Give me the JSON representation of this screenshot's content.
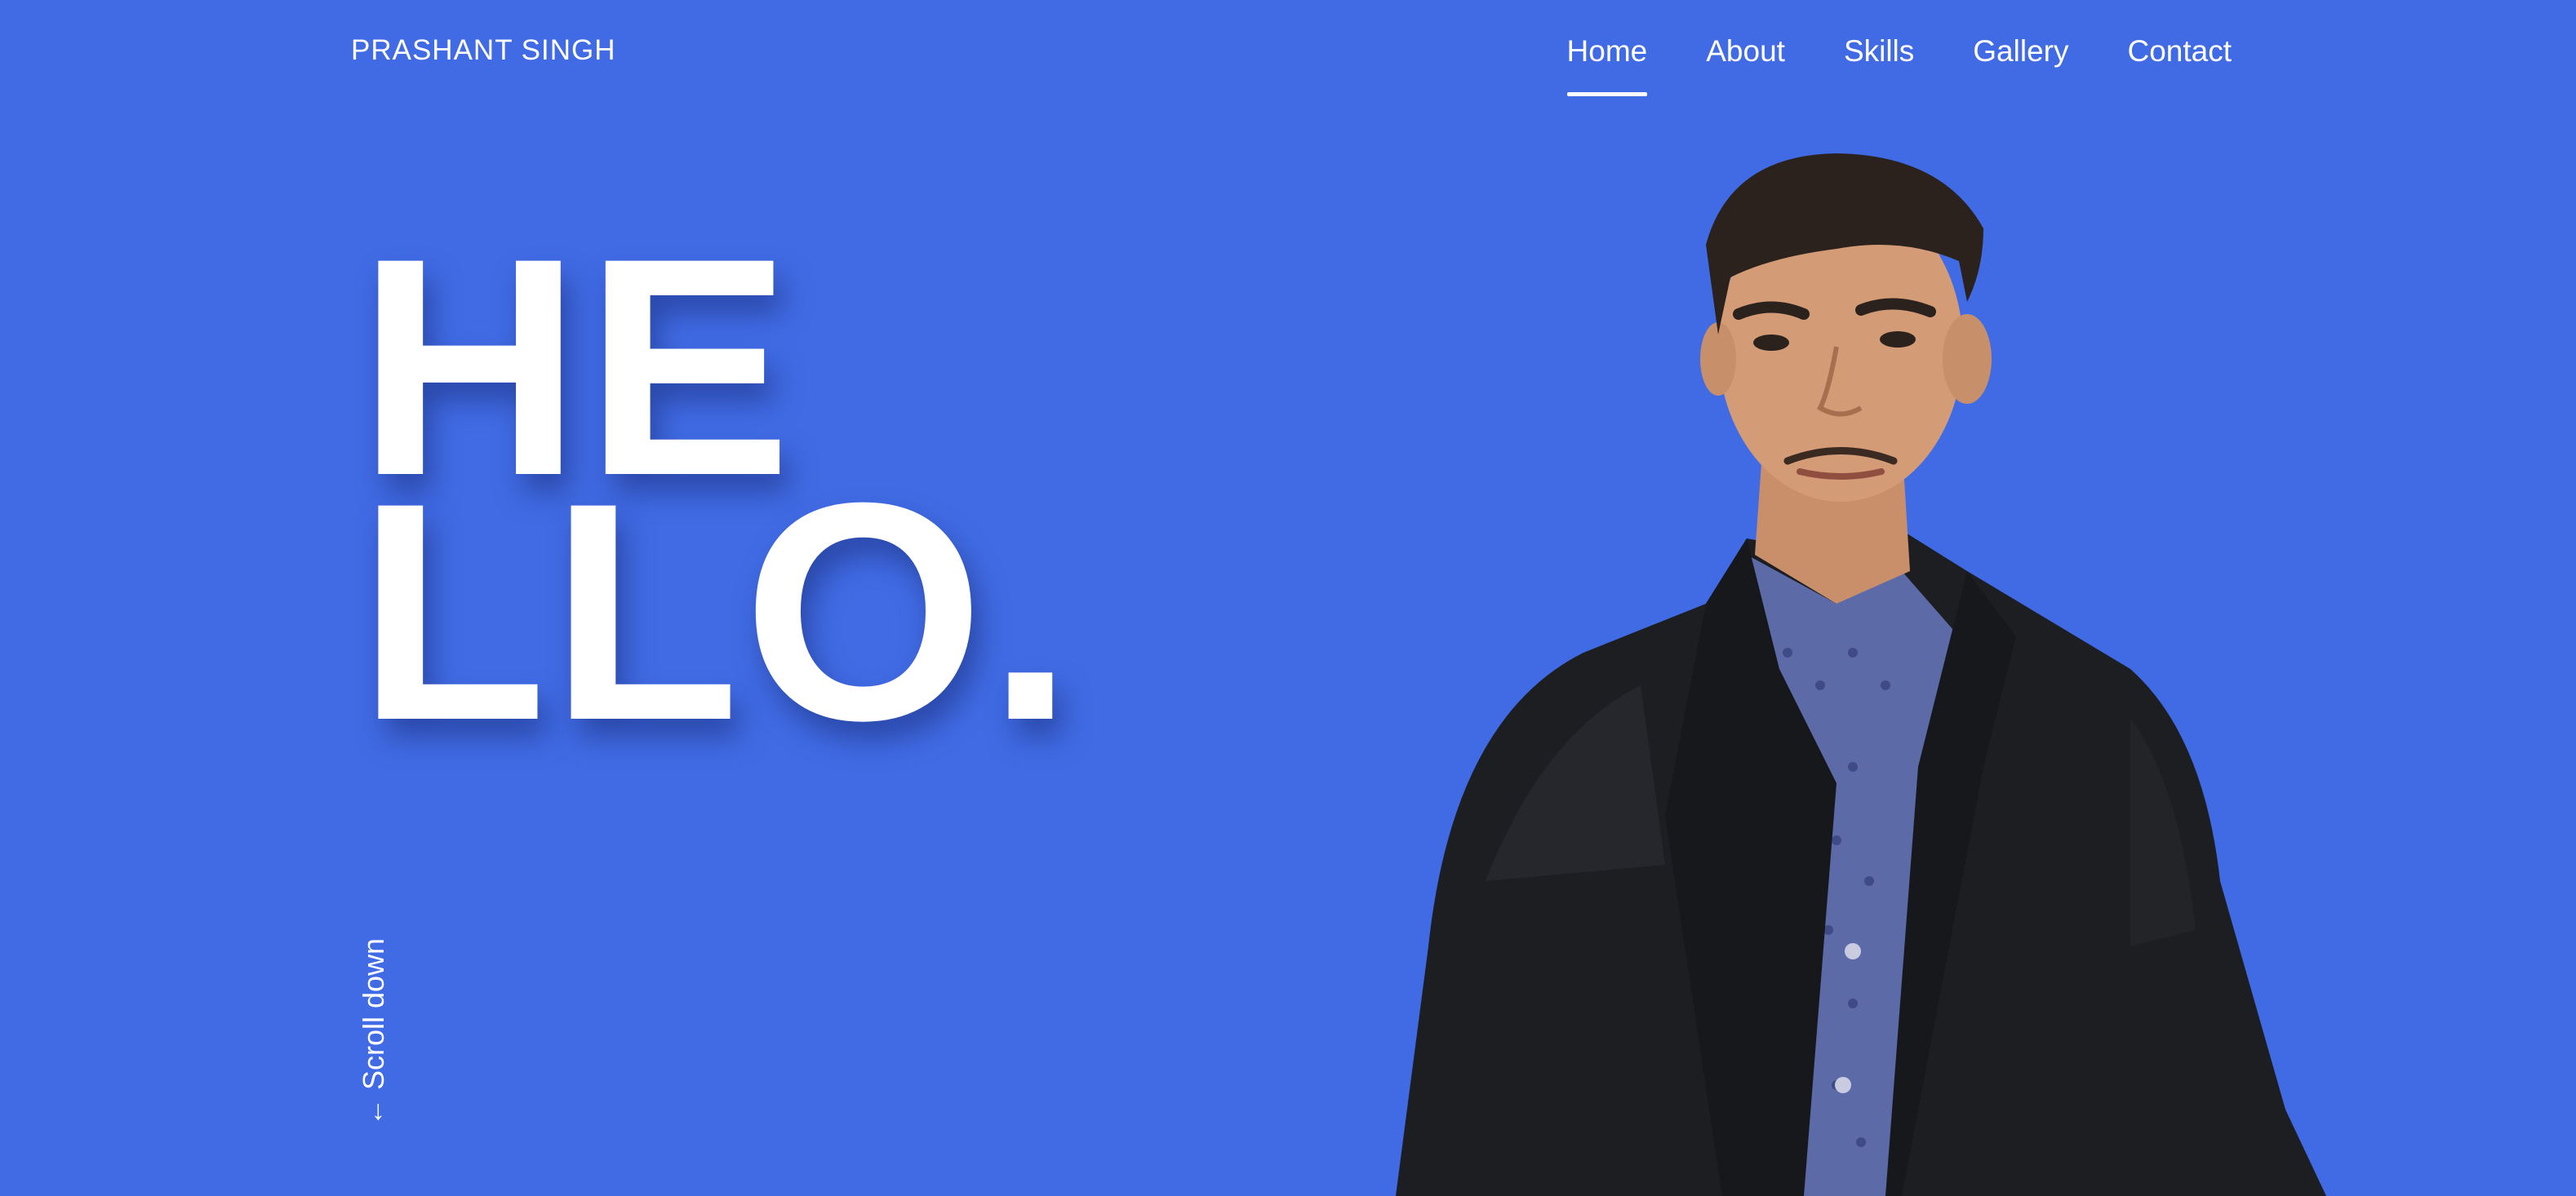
{
  "header": {
    "brand": "PRASHANT SINGH",
    "nav": [
      {
        "label": "Home",
        "active": true
      },
      {
        "label": "About",
        "active": false
      },
      {
        "label": "Skills",
        "active": false
      },
      {
        "label": "Gallery",
        "active": false
      },
      {
        "label": "Contact",
        "active": false
      }
    ]
  },
  "hero": {
    "headline_line1": "HE",
    "headline_line2": "LLO.",
    "scroll_label": "Scroll down",
    "scroll_icon": "arrow-down-icon",
    "portrait_icon": "person-portrait-photo"
  },
  "colors": {
    "background": "#416be4",
    "text": "#ffffff"
  }
}
